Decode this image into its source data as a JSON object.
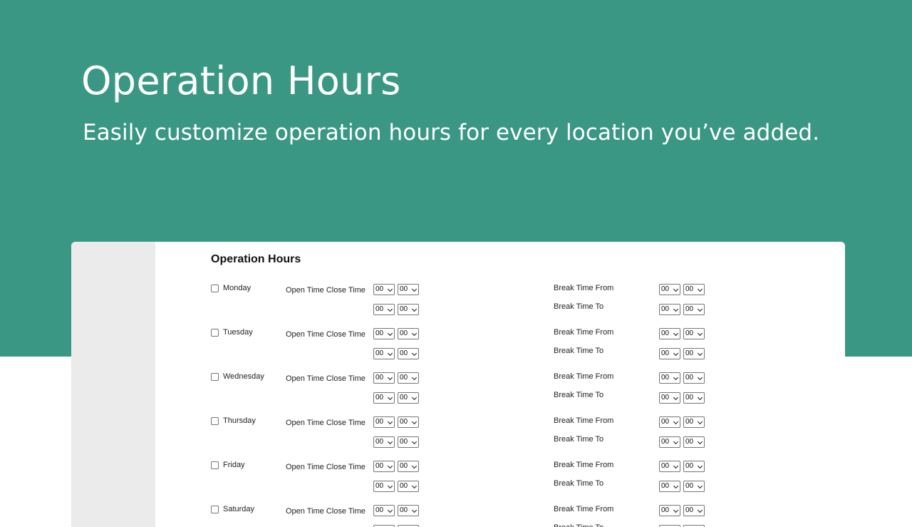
{
  "hero": {
    "title": "Operation Hours",
    "subtitle": "Easily customize operation hours for every location you’ve added."
  },
  "panel": {
    "section_title": "Operation Hours",
    "labels": {
      "open_close": "Open Time Close Time",
      "break_from": "Break Time From",
      "break_to": "Break Time To"
    },
    "select_value": "00",
    "days": [
      {
        "name": "Monday"
      },
      {
        "name": "Tuesday"
      },
      {
        "name": "Wednesday"
      },
      {
        "name": "Thursday"
      },
      {
        "name": "Friday"
      },
      {
        "name": "Saturday"
      }
    ]
  },
  "colors": {
    "brand_green": "#3a9784",
    "sidebar_gray": "#ebebeb"
  }
}
